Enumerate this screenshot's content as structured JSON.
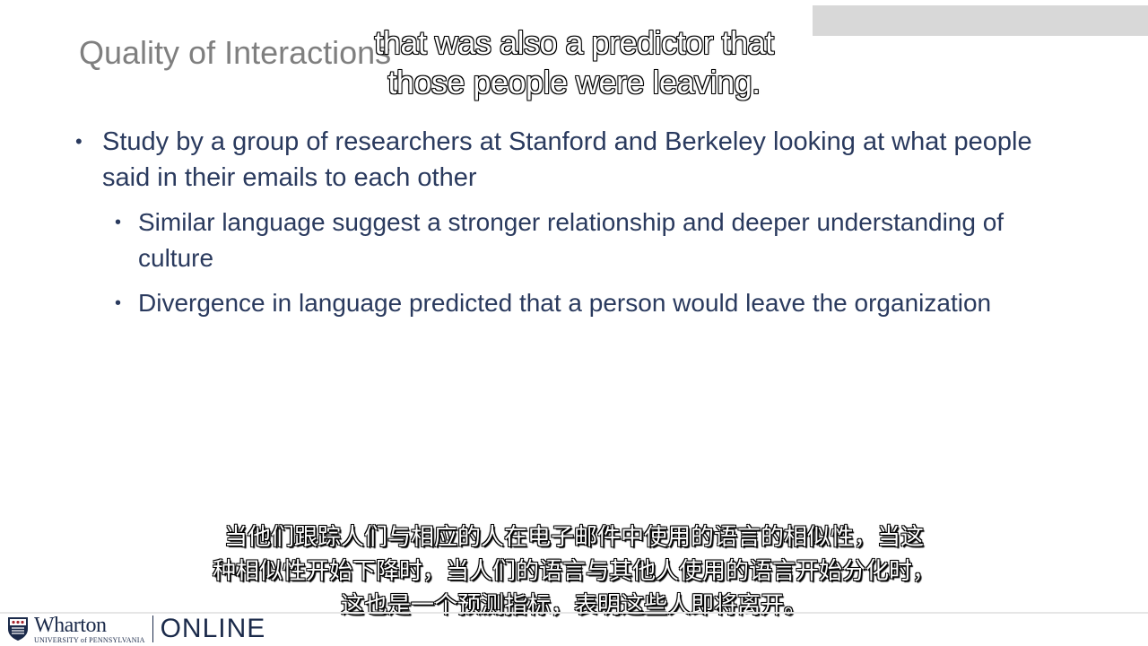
{
  "slide": {
    "title": "Quality of Interactions",
    "bullets": [
      {
        "text": "Study by a group of researchers at Stanford and Berkeley looking at what people said in their emails to each other",
        "sub": [
          "Similar language suggest a stronger relationship and deeper understanding of culture",
          "Divergence in language predicted that a person would leave the organization"
        ]
      }
    ]
  },
  "captions": {
    "english": [
      "that was also a predictor that",
      "those people were leaving."
    ],
    "chinese": [
      "当他们跟踪人们与相应的人在电子邮件中使用的语言的相似性，当这",
      "种相似性开始下降时，当人们的语言与其他人使用的语言开始分化时，",
      "这也是一个预测指标，表明这些人即将离开。"
    ]
  },
  "footer": {
    "logo_main": "Wharton",
    "logo_sub": "UNIVERSITY of PENNSYLVANIA",
    "logo_online": "ONLINE"
  },
  "colors": {
    "title": "#7f7f7f",
    "body_text": "#2a3a5e",
    "brand_navy": "#1b2a4a",
    "top_bar": "#d8d8d8"
  },
  "icons": {
    "logo": "penn-shield-icon"
  }
}
